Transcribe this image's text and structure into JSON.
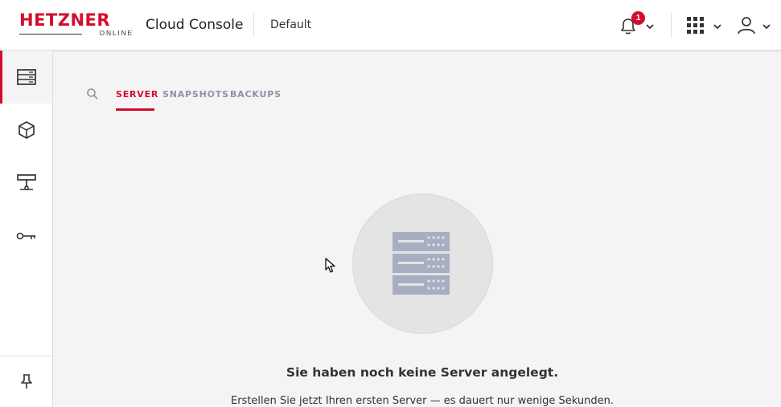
{
  "header": {
    "logo": {
      "word": "HETZNER",
      "sub": "ONLINE"
    },
    "app_title": "Cloud Console",
    "project": "Default",
    "notifications_count": "1",
    "icons": [
      "bell-icon",
      "chevron-down-icon",
      "apps-grid-icon",
      "user-icon"
    ]
  },
  "sidebar": {
    "items": [
      {
        "name": "servers",
        "icon": "server-stack-icon",
        "active": true
      },
      {
        "name": "volumes",
        "icon": "cube-icon",
        "active": false
      },
      {
        "name": "networks",
        "icon": "network-icon",
        "active": false
      },
      {
        "name": "ssh-keys",
        "icon": "key-icon",
        "active": false
      }
    ],
    "footer_icon": "pin-icon"
  },
  "tabs": [
    {
      "label": "SERVER",
      "active": true
    },
    {
      "label": "SNAPSHOTS",
      "active": false
    },
    {
      "label": "BACKUPS",
      "active": false
    }
  ],
  "empty_state": {
    "icon": "server-rack-icon",
    "title": "Sie haben noch keine Server angelegt.",
    "subtitle": "Erstellen Sie jetzt Ihren ersten Server — es dauert nur wenige Sekunden."
  },
  "colors": {
    "brand_red": "#d50c2d",
    "tab_inactive": "#8c93a3",
    "icon_gray": "#a8aec2"
  }
}
